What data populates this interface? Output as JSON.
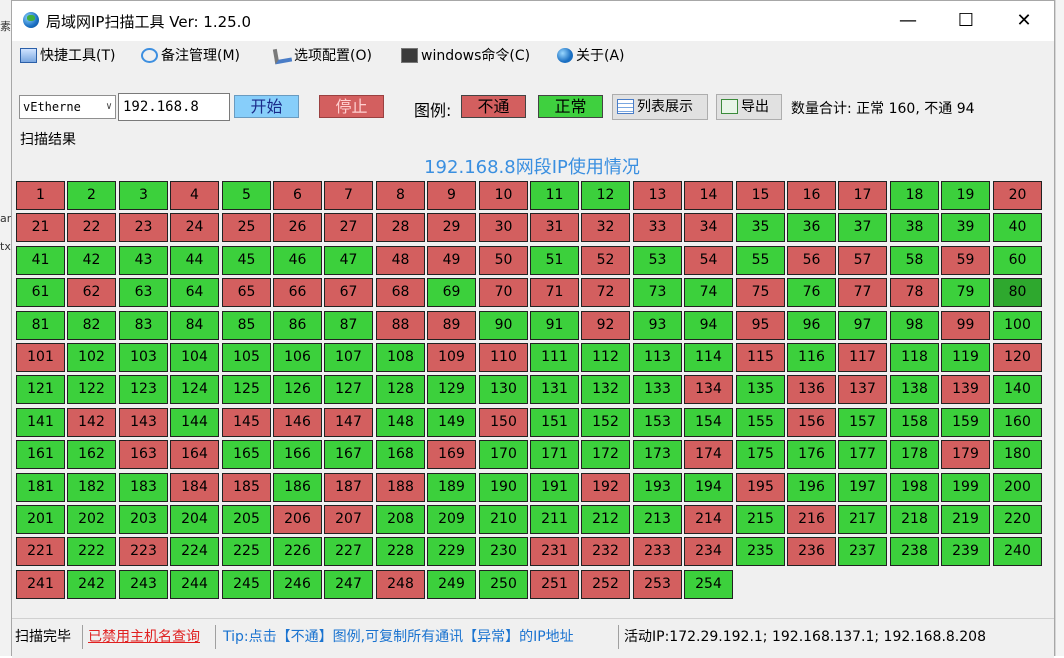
{
  "window": {
    "title": "局域网IP扫描工具  Ver: 1.25.0"
  },
  "menu": [
    {
      "label": "快捷工具(T)",
      "icon": "tools-icon"
    },
    {
      "label": "备注管理(M)",
      "icon": "speech-bubble-icon"
    },
    {
      "label": "选项配置(O)",
      "icon": "wrench-icon"
    },
    {
      "label": "windows命令(C)",
      "icon": "console-icon"
    },
    {
      "label": "关于(A)",
      "icon": "globe-icon"
    }
  ],
  "toolbar": {
    "adapter": "vEtherne",
    "ip_prefix": "192.168.8",
    "start_label": "开始",
    "stop_label": "停止",
    "legend_label": "图例:",
    "legend_bad": "不通",
    "legend_ok": "正常",
    "list_view_label": "列表展示",
    "export_label": "导出",
    "count_summary": "数量合计: 正常 160, 不通 94"
  },
  "results": {
    "group_label": "扫描结果",
    "heading": "192.168.8网段IP使用情况",
    "selected_cell": 80,
    "colors": {
      "ok": "#3cd03c",
      "bad": "#d35f5f",
      "selected": "#2ea82e"
    },
    "down_hosts": [
      1,
      4,
      6,
      7,
      8,
      9,
      10,
      13,
      14,
      15,
      16,
      17,
      20,
      21,
      22,
      23,
      24,
      25,
      26,
      27,
      28,
      29,
      30,
      31,
      32,
      33,
      34,
      48,
      49,
      50,
      52,
      54,
      56,
      57,
      59,
      62,
      65,
      66,
      67,
      68,
      70,
      71,
      72,
      75,
      77,
      78,
      88,
      89,
      92,
      95,
      99,
      101,
      109,
      110,
      115,
      117,
      120,
      134,
      136,
      137,
      139,
      142,
      143,
      145,
      146,
      147,
      150,
      156,
      163,
      164,
      169,
      174,
      179,
      184,
      185,
      187,
      188,
      192,
      195,
      206,
      207,
      214,
      216,
      221,
      223,
      231,
      232,
      233,
      234,
      236,
      241,
      248,
      251,
      252,
      253
    ]
  },
  "status": {
    "state": "扫描完毕",
    "hostname_query": "已禁用主机名查询",
    "tip": "Tip:点击【不通】图例,可复制所有通讯【异常】的IP地址",
    "active_ip": "活动IP:172.29.192.1; 192.168.137.1; 192.168.8.208"
  }
}
